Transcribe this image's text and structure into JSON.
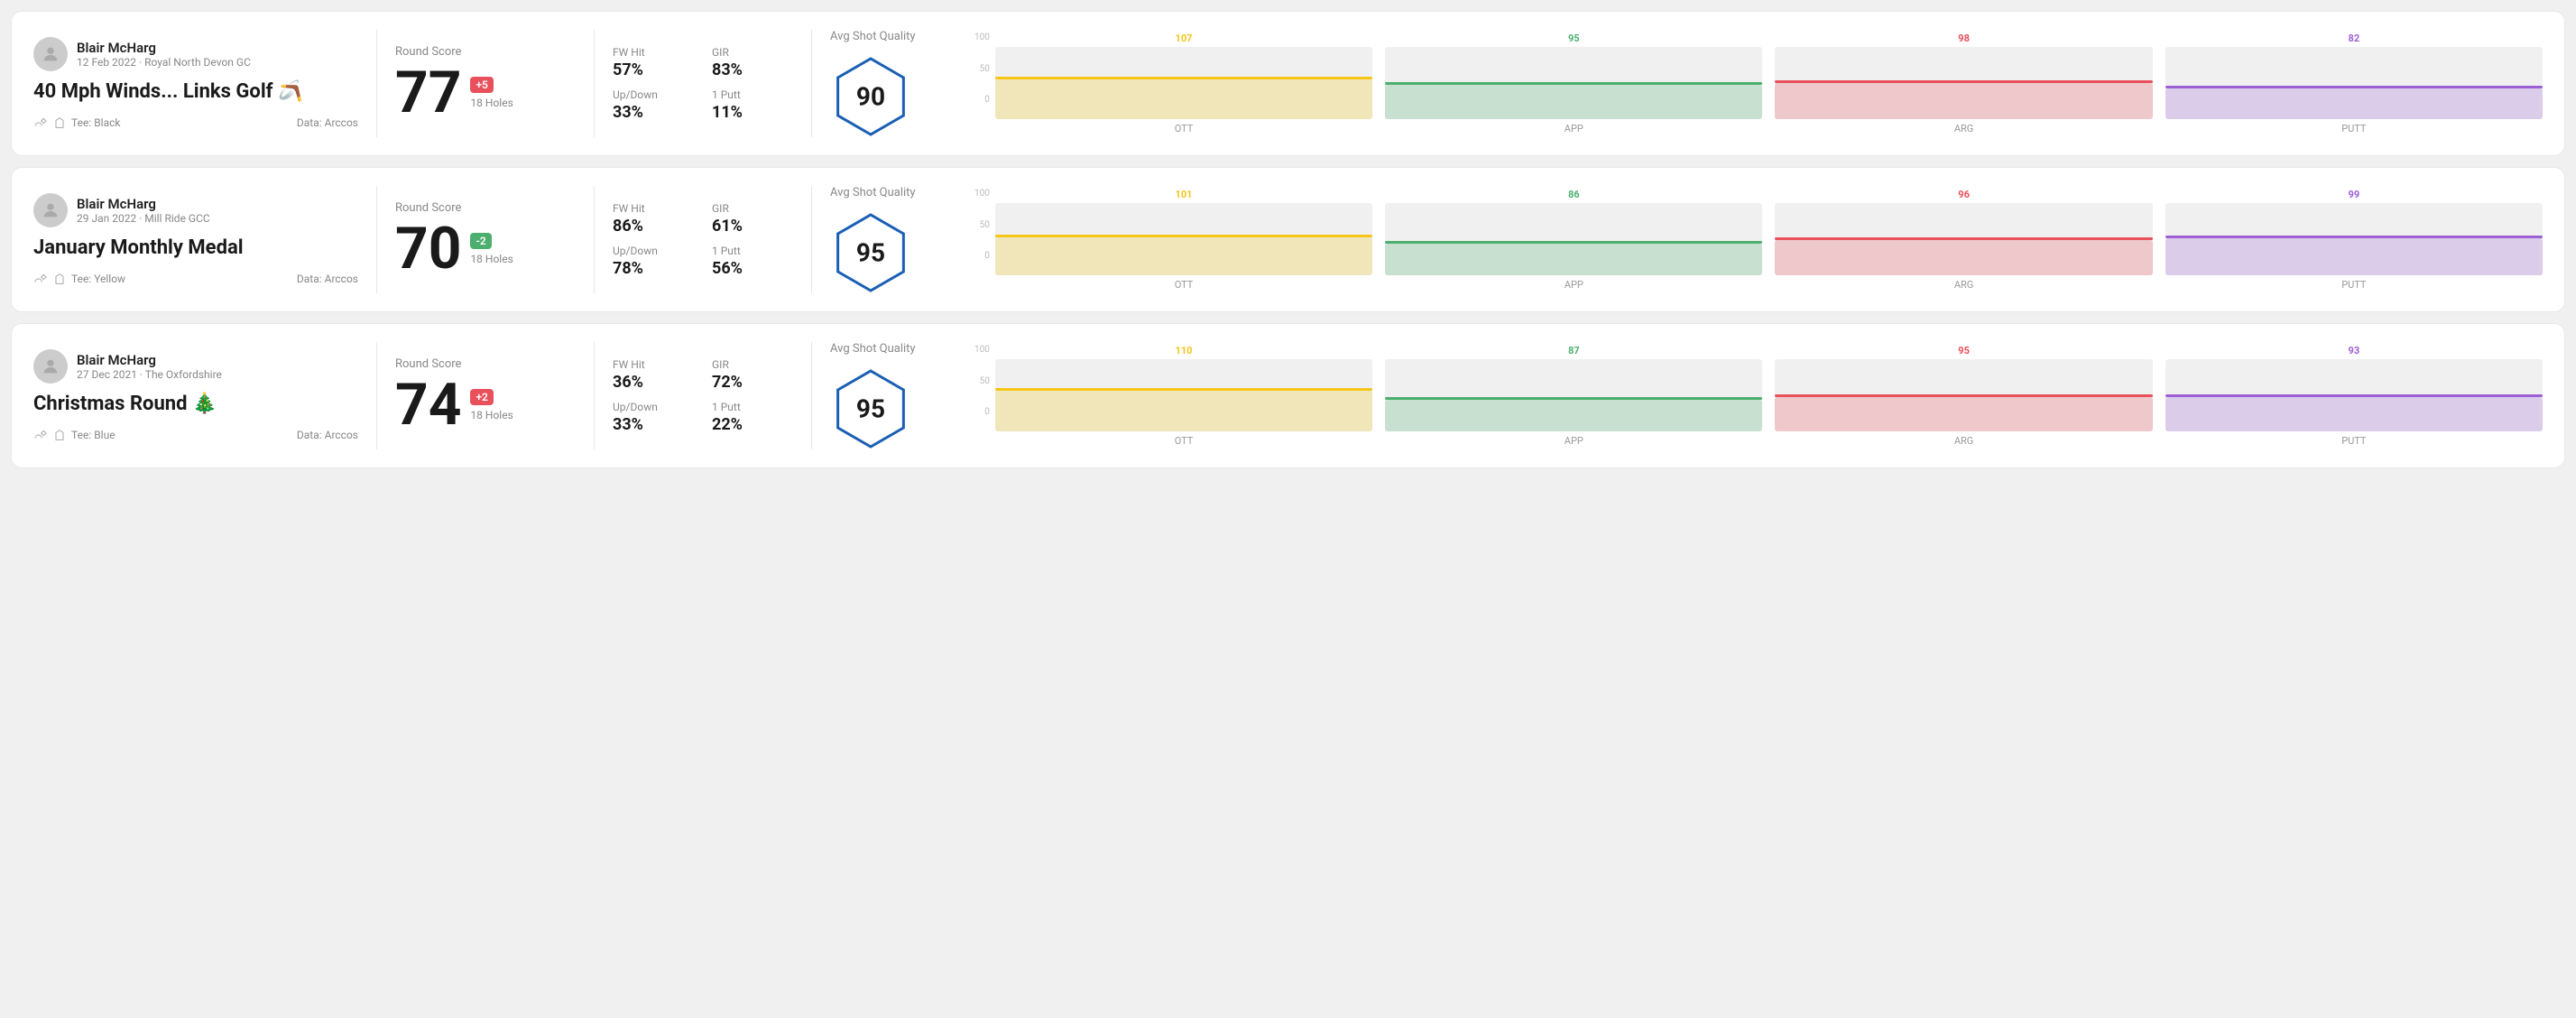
{
  "rounds": [
    {
      "id": "round-1",
      "player_name": "Blair McHarg",
      "date": "12 Feb 2022 · Royal North Devon GC",
      "title": "40 Mph Winds... Links Golf 🪃",
      "tee": "Tee: Black",
      "data_source": "Data: Arccos",
      "round_score_label": "Round Score",
      "score": "77",
      "score_diff": "+5",
      "score_diff_type": "positive",
      "holes": "18 Holes",
      "fw_hit_label": "FW Hit",
      "fw_hit": "57%",
      "gir_label": "GIR",
      "gir": "83%",
      "updown_label": "Up/Down",
      "updown": "33%",
      "putt1_label": "1 Putt",
      "putt1": "11%",
      "avg_shot_label": "Avg Shot Quality",
      "shot_quality": "90",
      "chart": {
        "bars": [
          {
            "label": "OTT",
            "value": 107,
            "color": "#f5c518",
            "bar_pct": 55
          },
          {
            "label": "APP",
            "value": 95,
            "color": "#4caf6e",
            "bar_pct": 48
          },
          {
            "label": "ARG",
            "value": 98,
            "color": "#e8505b",
            "bar_pct": 50
          },
          {
            "label": "PUTT",
            "value": 82,
            "color": "#9c5fd6",
            "bar_pct": 42
          }
        ]
      }
    },
    {
      "id": "round-2",
      "player_name": "Blair McHarg",
      "date": "29 Jan 2022 · Mill Ride GCC",
      "title": "January Monthly Medal",
      "tee": "Tee: Yellow",
      "data_source": "Data: Arccos",
      "round_score_label": "Round Score",
      "score": "70",
      "score_diff": "-2",
      "score_diff_type": "negative",
      "holes": "18 Holes",
      "fw_hit_label": "FW Hit",
      "fw_hit": "86%",
      "gir_label": "GIR",
      "gir": "61%",
      "updown_label": "Up/Down",
      "updown": "78%",
      "putt1_label": "1 Putt",
      "putt1": "56%",
      "avg_shot_label": "Avg Shot Quality",
      "shot_quality": "95",
      "chart": {
        "bars": [
          {
            "label": "OTT",
            "value": 101,
            "color": "#f5c518",
            "bar_pct": 52
          },
          {
            "label": "APP",
            "value": 86,
            "color": "#4caf6e",
            "bar_pct": 44
          },
          {
            "label": "ARG",
            "value": 96,
            "color": "#e8505b",
            "bar_pct": 49
          },
          {
            "label": "PUTT",
            "value": 99,
            "color": "#9c5fd6",
            "bar_pct": 51
          }
        ]
      }
    },
    {
      "id": "round-3",
      "player_name": "Blair McHarg",
      "date": "27 Dec 2021 · The Oxfordshire",
      "title": "Christmas Round 🎄",
      "tee": "Tee: Blue",
      "data_source": "Data: Arccos",
      "round_score_label": "Round Score",
      "score": "74",
      "score_diff": "+2",
      "score_diff_type": "positive",
      "holes": "18 Holes",
      "fw_hit_label": "FW Hit",
      "fw_hit": "36%",
      "gir_label": "GIR",
      "gir": "72%",
      "updown_label": "Up/Down",
      "updown": "33%",
      "putt1_label": "1 Putt",
      "putt1": "22%",
      "avg_shot_label": "Avg Shot Quality",
      "shot_quality": "95",
      "chart": {
        "bars": [
          {
            "label": "OTT",
            "value": 110,
            "color": "#f5c518",
            "bar_pct": 56
          },
          {
            "label": "APP",
            "value": 87,
            "color": "#4caf6e",
            "bar_pct": 44
          },
          {
            "label": "ARG",
            "value": 95,
            "color": "#e8505b",
            "bar_pct": 48
          },
          {
            "label": "PUTT",
            "value": 93,
            "color": "#9c5fd6",
            "bar_pct": 47
          }
        ]
      }
    }
  ],
  "chart_axis": {
    "top": "100",
    "mid": "50",
    "bot": "0"
  }
}
